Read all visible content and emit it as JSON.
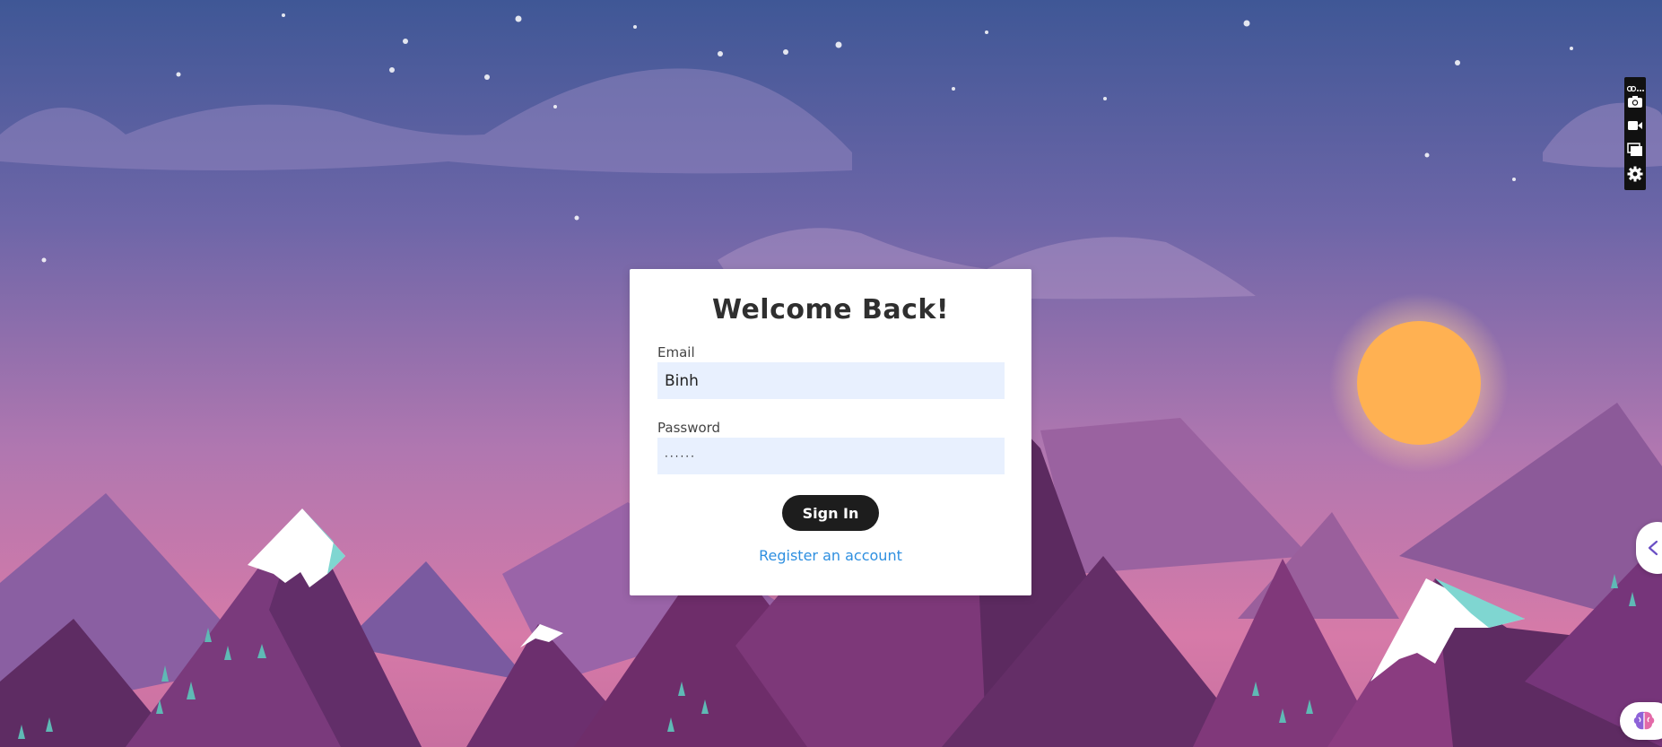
{
  "login": {
    "title": "Welcome Back!",
    "email_label": "Email",
    "email_value": "Binh",
    "password_label": "Password",
    "password_value": "······",
    "signin_label": "Sign In",
    "register_label": "Register an account"
  },
  "extension_toolbar": {
    "items": [
      "link-icon",
      "more-icon",
      "camera-icon",
      "video-camera-icon",
      "window-stack-icon",
      "gear-icon"
    ]
  },
  "side_controls": {
    "collapse_icon": "chevron-left-icon",
    "assistant_icon": "brain-icon"
  },
  "colors": {
    "sky_top": "#3f5796",
    "sky_bottom": "#d07aae",
    "sun": "#ffb152",
    "button": "#1d1d1d",
    "link": "#2e8fe0",
    "input_bg": "#e8f0fe"
  }
}
